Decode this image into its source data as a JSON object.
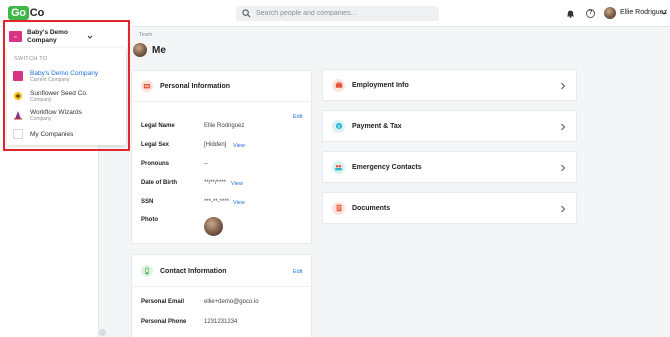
{
  "brand": {
    "logo_go": "Go",
    "logo_co": "Co"
  },
  "search": {
    "placeholder": "Search people and companies..."
  },
  "user": {
    "name": "Ellie Rodriguez"
  },
  "company_switcher": {
    "current_name": "Baby's Demo Company",
    "heading": "SWITCH TO",
    "items": [
      {
        "title": "Baby's Demo Company",
        "subtitle": "Current Company",
        "active": true
      },
      {
        "title": "Sunflower Seed Co.",
        "subtitle": "Company"
      },
      {
        "title": "Workflow Wizards",
        "subtitle": "Company"
      },
      {
        "title": "My Companies",
        "subtitle": ""
      }
    ]
  },
  "breadcrumb": "Team",
  "page_title": "Me",
  "personal_info": {
    "title": "Personal Information",
    "edit_label": "Edit",
    "rows": [
      {
        "label": "Legal Name",
        "value": "Ellie Rodriguez"
      },
      {
        "label": "Legal Sex",
        "value": "[Hidden]",
        "action": "View"
      },
      {
        "label": "Pronouns",
        "value": "--"
      },
      {
        "label": "Date of Birth",
        "value": "**/**/****",
        "action": "View"
      },
      {
        "label": "SSN",
        "value": "***-**-****",
        "action": "View"
      },
      {
        "label": "Photo",
        "value": ""
      }
    ]
  },
  "contact_info": {
    "title": "Contact Information",
    "edit_label": "Edit",
    "rows": [
      {
        "label": "Personal Email",
        "value": "ellie+demo@goco.io"
      },
      {
        "label": "Personal Phone",
        "value": "1231231234"
      }
    ]
  },
  "nav_cards": [
    {
      "label": "Employment Info",
      "icon": "briefcase-icon",
      "color": "#e8553d"
    },
    {
      "label": "Payment & Tax",
      "icon": "money-icon",
      "color": "#2ab6c9"
    },
    {
      "label": "Emergency Contacts",
      "icon": "people-icon",
      "color": "#2ab6c9"
    },
    {
      "label": "Documents",
      "icon": "document-icon",
      "color": "#e8553d"
    }
  ],
  "colors": {
    "accent_blue": "#1d6fdc",
    "brand_green": "#41b649",
    "highlight_red": "#e0262b"
  }
}
